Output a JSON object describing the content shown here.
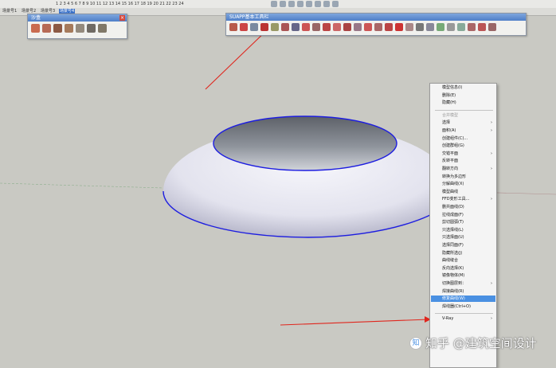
{
  "topbar": {
    "text": "1 2 3 4 5 6 7 8 9 10 11 12 13 14 15 16 17 18 19 20 21 22 23 24"
  },
  "scene_tabs": [
    "场景号1",
    "场景号2",
    "场景号3",
    "场景号4"
  ],
  "sandbox_toolbar": {
    "title": "沙盒",
    "close_label": "×",
    "tool_icons": [
      "sandbox-contours-icon",
      "sandbox-scratch-icon",
      "sandbox-smoove-icon",
      "sandbox-stamp-icon",
      "sandbox-drape-icon",
      "sandbox-add-detail-icon",
      "sandbox-flip-edge-icon"
    ]
  },
  "suapp_toolbar": {
    "title": "SUAPP基本工具栏",
    "tool_count": 26
  },
  "context_menu": {
    "items": [
      {
        "label": "模型信息(I)",
        "disabled": false,
        "submenu": false
      },
      {
        "label": "删除(E)",
        "disabled": false,
        "submenu": false
      },
      {
        "label": "隐藏(H)",
        "disabled": false,
        "submenu": false
      },
      {
        "sep": true
      },
      {
        "label": "合并模型",
        "disabled": true,
        "submenu": false
      },
      {
        "label": "选择",
        "disabled": false,
        "submenu": true
      },
      {
        "label": "面积(A)",
        "disabled": false,
        "submenu": true
      },
      {
        "label": "创建组件(C)...",
        "disabled": false,
        "submenu": false
      },
      {
        "label": "创建群组(G)",
        "disabled": false,
        "submenu": false
      },
      {
        "label": "交错平面",
        "disabled": false,
        "submenu": true
      },
      {
        "label": "反转平面",
        "disabled": false,
        "submenu": false
      },
      {
        "label": "翻转方向",
        "disabled": false,
        "submenu": true
      },
      {
        "label": "转换为多边形",
        "disabled": false,
        "submenu": false
      },
      {
        "label": "分解曲线(X)",
        "disabled": false,
        "submenu": false
      },
      {
        "label": "模型曲线",
        "disabled": false,
        "submenu": false
      },
      {
        "label": "FFD变形工具...",
        "disabled": false,
        "submenu": true
      },
      {
        "label": "删共面线(D)",
        "disabled": false,
        "submenu": false
      },
      {
        "label": "拉线成面(F)",
        "disabled": false,
        "submenu": false
      },
      {
        "label": "剪切圆弧(T)",
        "disabled": false,
        "submenu": false
      },
      {
        "label": "只选择线(L)",
        "disabled": false,
        "submenu": false
      },
      {
        "label": "只选择面(U)",
        "disabled": false,
        "submenu": false
      },
      {
        "label": "选择同面(F)",
        "disabled": false,
        "submenu": false
      },
      {
        "label": "隐藏所选(J)",
        "disabled": false,
        "submenu": false
      },
      {
        "label": "曲线缝合",
        "disabled": false,
        "submenu": false
      },
      {
        "label": "反向选择(K)",
        "disabled": false,
        "submenu": false
      },
      {
        "label": "镜像物体(M)",
        "disabled": false,
        "submenu": false
      },
      {
        "label": "切换图层到：",
        "disabled": false,
        "submenu": true
      },
      {
        "label": "焊接曲线(R)",
        "disabled": false,
        "submenu": false
      },
      {
        "label": "修复曲线(W)",
        "disabled": false,
        "submenu": false,
        "highlight": true
      },
      {
        "label": "焊线器(Ctrl+O)",
        "disabled": false,
        "submenu": false
      },
      {
        "sep": true
      },
      {
        "label": "V-Ray",
        "disabled": false,
        "submenu": true
      }
    ]
  },
  "watermark": {
    "logo": "知",
    "text": "知乎 @建筑空间设计"
  },
  "colors": {
    "canvas_bg": "#c9c9c3",
    "toolbar_title": "#4f7fc8",
    "menu_highlight": "#4a90e2",
    "edge_blue": "#1d1de0",
    "annotation_red": "#e0261d"
  }
}
